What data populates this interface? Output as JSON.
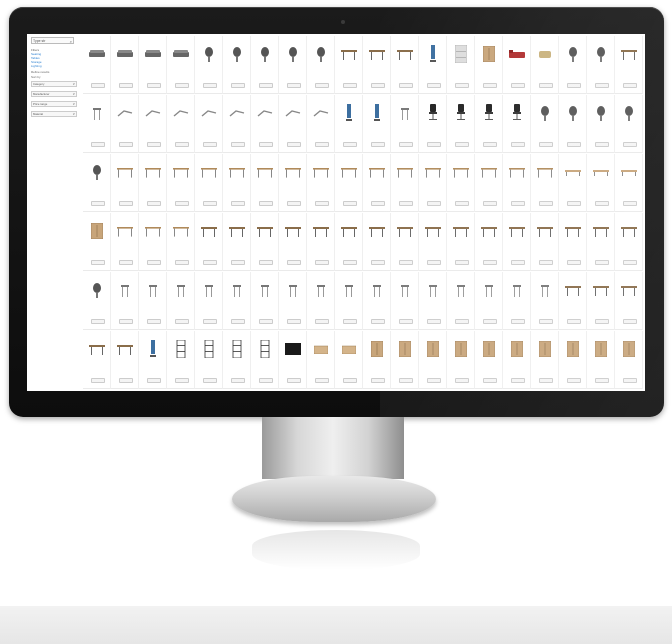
{
  "sidebar": {
    "search_placeholder": "Type str",
    "heading": "Filters",
    "links": [
      "Seating",
      "Tables",
      "Storage",
      "Lighting"
    ],
    "section": "Refine results",
    "section2": "Sort by",
    "dropdowns": [
      "Category",
      "Manufacturer",
      "Price range",
      "Material"
    ]
  },
  "product_rows": [
    {
      "row": 1,
      "kinds": [
        "sofa",
        "sofa",
        "sofa",
        "sofa",
        "chair",
        "chair",
        "chair",
        "chair",
        "chair",
        "table",
        "table",
        "table",
        "lamp",
        "shelf",
        "cabinet",
        "bed",
        "armchair",
        "chair",
        "chair",
        "table"
      ]
    },
    {
      "row": 2,
      "kinds": [
        "stool",
        "arm",
        "arm",
        "arm",
        "arm",
        "arm",
        "arm",
        "arm",
        "arm",
        "lamp",
        "lamp",
        "stool",
        "office-chair",
        "office-chair",
        "office-chair",
        "office-chair",
        "chair",
        "chair",
        "chair",
        "chair"
      ]
    },
    {
      "row": 3,
      "kinds": [
        "chair",
        "desk",
        "desk",
        "desk",
        "desk",
        "desk",
        "desk",
        "desk",
        "desk",
        "desk",
        "desk",
        "desk",
        "desk",
        "desk",
        "desk",
        "desk",
        "desk",
        "bench",
        "bench",
        "bench"
      ]
    },
    {
      "row": 4,
      "kinds": [
        "cabinet",
        "desk",
        "desk",
        "desk",
        "table",
        "table",
        "table",
        "table",
        "table",
        "table",
        "table",
        "table",
        "table",
        "table",
        "table",
        "table",
        "table",
        "table",
        "table",
        "table"
      ]
    },
    {
      "row": 5,
      "kinds": [
        "chair",
        "stool",
        "stool",
        "stool",
        "stool",
        "stool",
        "stool",
        "stool",
        "stool",
        "stool",
        "stool",
        "stool",
        "stool",
        "stool",
        "stool",
        "stool",
        "stool",
        "table",
        "table",
        "table"
      ]
    },
    {
      "row": 6,
      "kinds": [
        "table",
        "table",
        "lamp",
        "rack",
        "rack",
        "rack",
        "rack",
        "board",
        "box",
        "box",
        "cabinet",
        "cabinet",
        "cabinet",
        "cabinet",
        "cabinet",
        "cabinet",
        "cabinet",
        "cabinet",
        "cabinet",
        "cabinet"
      ]
    }
  ],
  "colors": {
    "bezel": "#111111",
    "screen": "#ffffff",
    "link": "#2a7fd0"
  }
}
